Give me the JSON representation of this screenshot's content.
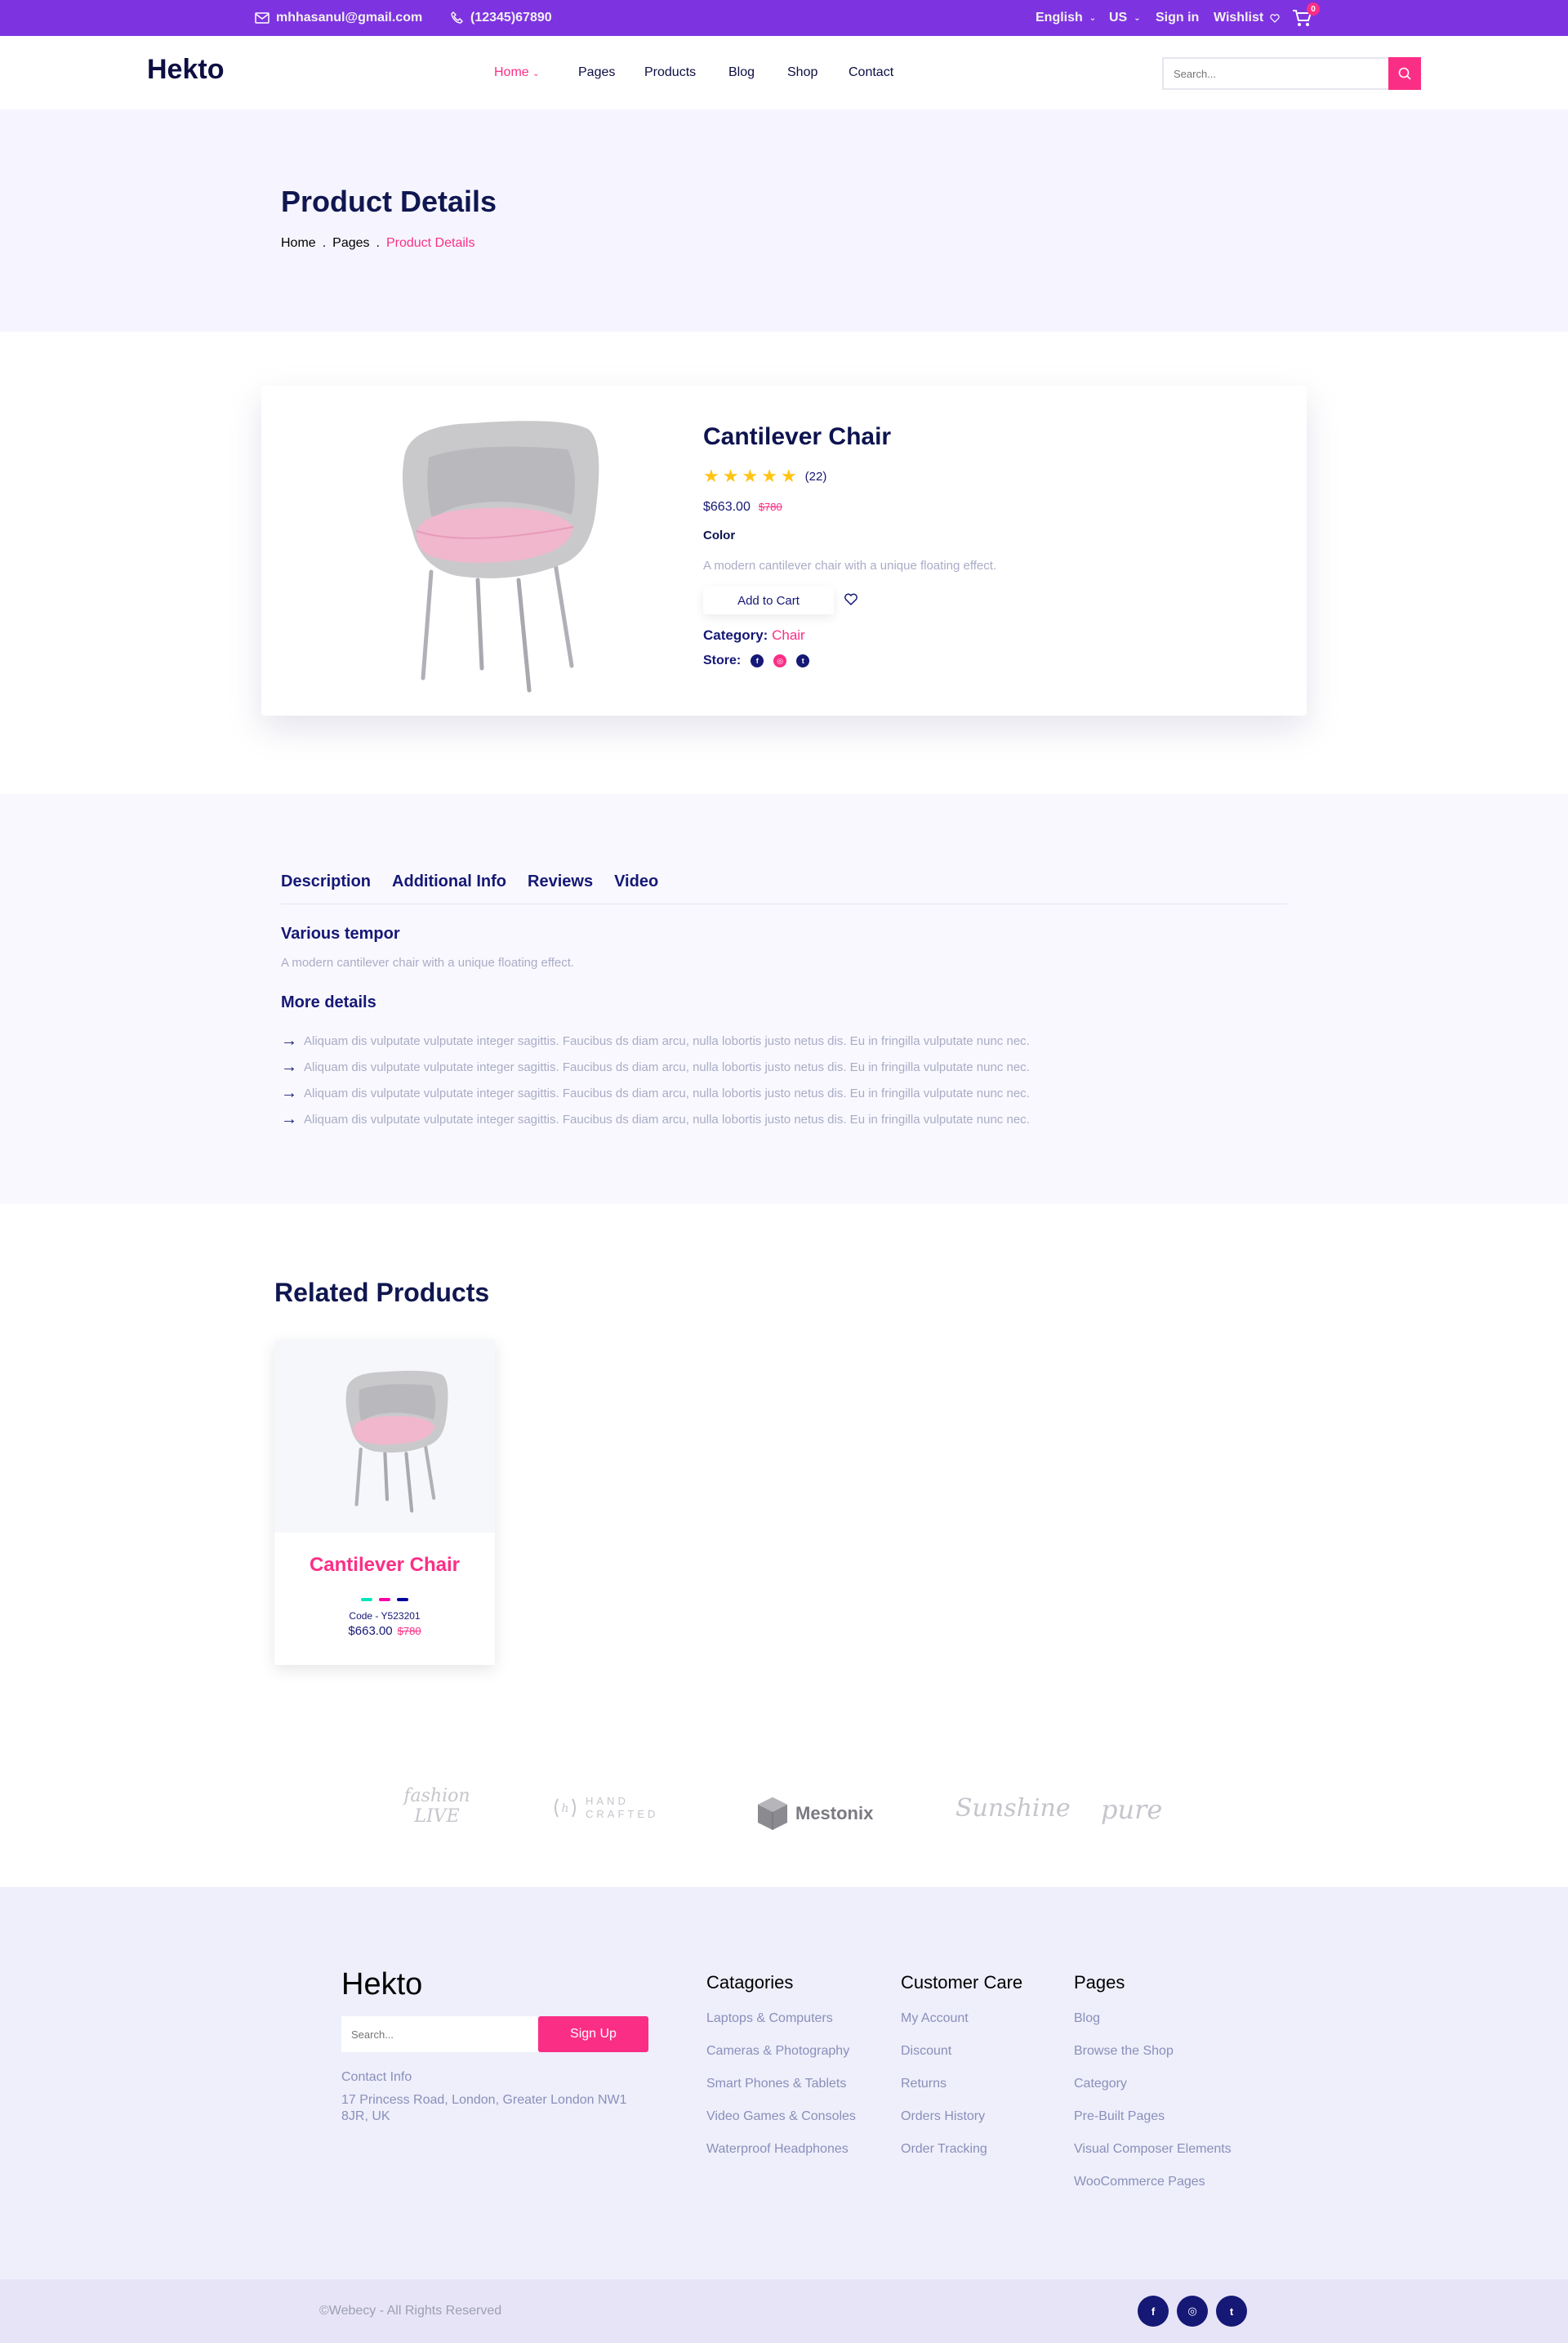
{
  "topbar": {
    "email": "mhhasanul@gmail.com",
    "phone": "(12345)67890",
    "language": "English",
    "currency": "US",
    "sign_in": "Sign in",
    "wishlist": "Wishlist",
    "cart_count": "0"
  },
  "nav": {
    "logo": "Hekto",
    "links": [
      "Home",
      "Pages",
      "Products",
      "Blog",
      "Shop",
      "Contact"
    ],
    "search_placeholder": "Search..."
  },
  "hero": {
    "title": "Product Details",
    "breadcrumb": [
      "Home",
      "Pages",
      "Product Details"
    ]
  },
  "product": {
    "name": "Cantilever Chair",
    "rating": 5,
    "rating_count": "(22)",
    "price": "$663.00",
    "old_price": "$780",
    "color_label": "Color",
    "description": "A modern cantilever chair with a unique floating effect.",
    "add_to_cart": "Add to Cart",
    "category_label": "Category:",
    "category_value": "Chair",
    "store_label": "Store:"
  },
  "tabs": {
    "items": [
      "Description",
      "Additional Info",
      "Reviews",
      "Video"
    ],
    "heading1": "Various tempor",
    "text1": "A modern cantilever chair with a unique floating effect.",
    "heading2": "More details",
    "details": [
      "Aliquam dis vulputate vulputate integer sagittis. Faucibus ds diam arcu, nulla lobortis justo netus dis. Eu in fringilla vulputate nunc nec.",
      "Aliquam dis vulputate vulputate integer sagittis. Faucibus ds diam arcu, nulla lobortis justo netus dis. Eu in fringilla vulputate nunc nec.",
      "Aliquam dis vulputate vulputate integer sagittis. Faucibus ds diam arcu, nulla lobortis justo netus dis. Eu in fringilla vulputate nunc nec.",
      "Aliquam dis vulputate vulputate integer sagittis. Faucibus ds diam arcu, nulla lobortis justo netus dis. Eu in fringilla vulputate nunc nec."
    ]
  },
  "related": {
    "title": "Related Products",
    "card": {
      "name": "Cantilever Chair",
      "code": "Code - Y523201",
      "price": "$663.00",
      "old_price": "$780",
      "dot_colors": [
        "#05E6B7",
        "#F701A8",
        "#00009D"
      ]
    }
  },
  "brands": [
    "fashion LIVE",
    "HAND CRAFTED",
    "Mestonix",
    "Sunshine",
    "pure"
  ],
  "footer": {
    "logo": "Hekto",
    "search_placeholder": "Search...",
    "signup": "Sign Up",
    "contact_label": "Contact Info",
    "address": "17 Princess Road, London, Greater London NW1 8JR, UK",
    "columns": [
      {
        "title": "Catagories",
        "links": [
          "Laptops & Computers",
          "Cameras & Photography",
          "Smart Phones & Tablets",
          "Video Games & Consoles",
          "Waterproof Headphones"
        ]
      },
      {
        "title": "Customer Care",
        "links": [
          "My Account",
          "Discount",
          "Returns",
          "Orders History",
          "Order Tracking"
        ]
      },
      {
        "title": "Pages",
        "links": [
          "Blog",
          "Browse the Shop",
          "Category",
          "Pre-Built Pages",
          "Visual Composer Elements",
          "WooCommerce Pages"
        ]
      }
    ],
    "copyright": "©Webecy - All Rights Reserved"
  },
  "colors": {
    "primary_purple": "#7E33E0",
    "accent_pink": "#FB2E86",
    "navy": "#151875",
    "star": "#FFC416"
  }
}
